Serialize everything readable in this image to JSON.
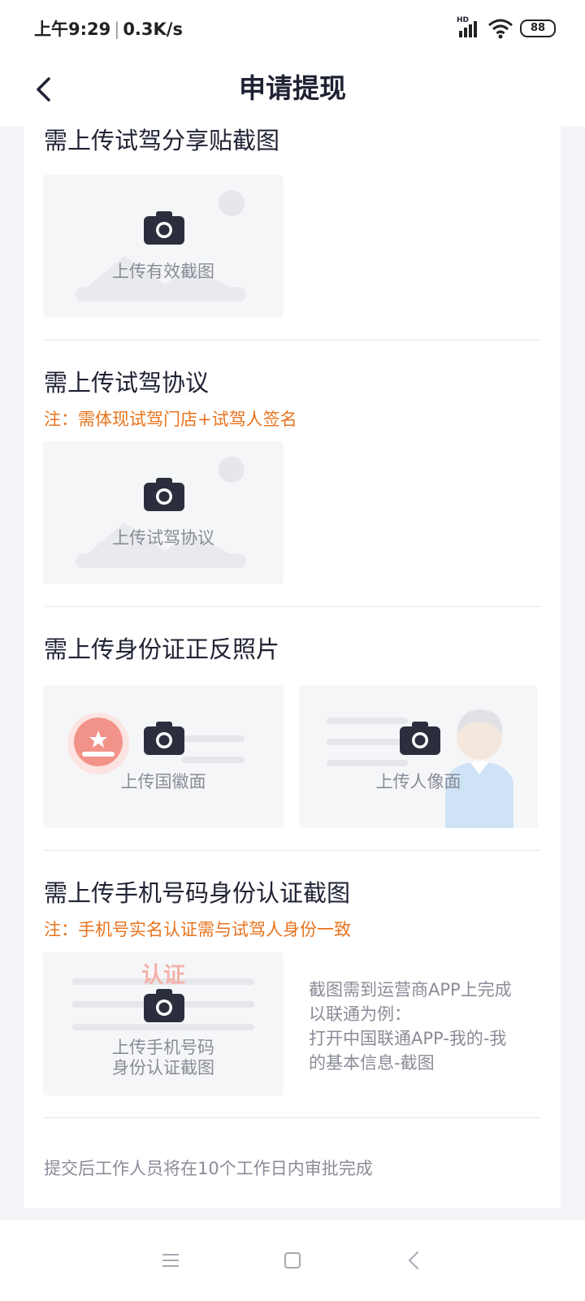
{
  "status": {
    "time": "上午9:29",
    "speed": "0.3K/s",
    "signal_label": "HD",
    "battery": "88"
  },
  "header": {
    "title": "申请提现"
  },
  "sections": [
    {
      "title": "需上传试驾分享贴截图",
      "upload_label": "上传有效截图"
    },
    {
      "title": "需上传试驾协议",
      "note": "注：需体现试驾门店+试驾人签名",
      "upload_label": "上传试驾协议"
    },
    {
      "title": "需上传身份证正反照片",
      "upload_front_label": "上传国徽面",
      "upload_back_label": "上传人像面"
    },
    {
      "title": "需上传手机号码身份认证截图",
      "note": "注：手机号实名认证需与试驾人身份一致",
      "upload_label_line1": "上传手机号码",
      "upload_label_line2": "身份认证截图",
      "stamp_text": "认证",
      "instructions": [
        "截图需到运营商APP上完成",
        "以联通为例：",
        "打开中国联通APP-我的-我",
        "的基本信息-截图"
      ]
    }
  ],
  "footer_note": "提交后工作人员将在10个工作日内审批完成",
  "colors": {
    "accent": "#e8731e",
    "camera": "#2b2e3d",
    "text_primary": "#1f2233",
    "text_secondary": "#8a8c97"
  }
}
